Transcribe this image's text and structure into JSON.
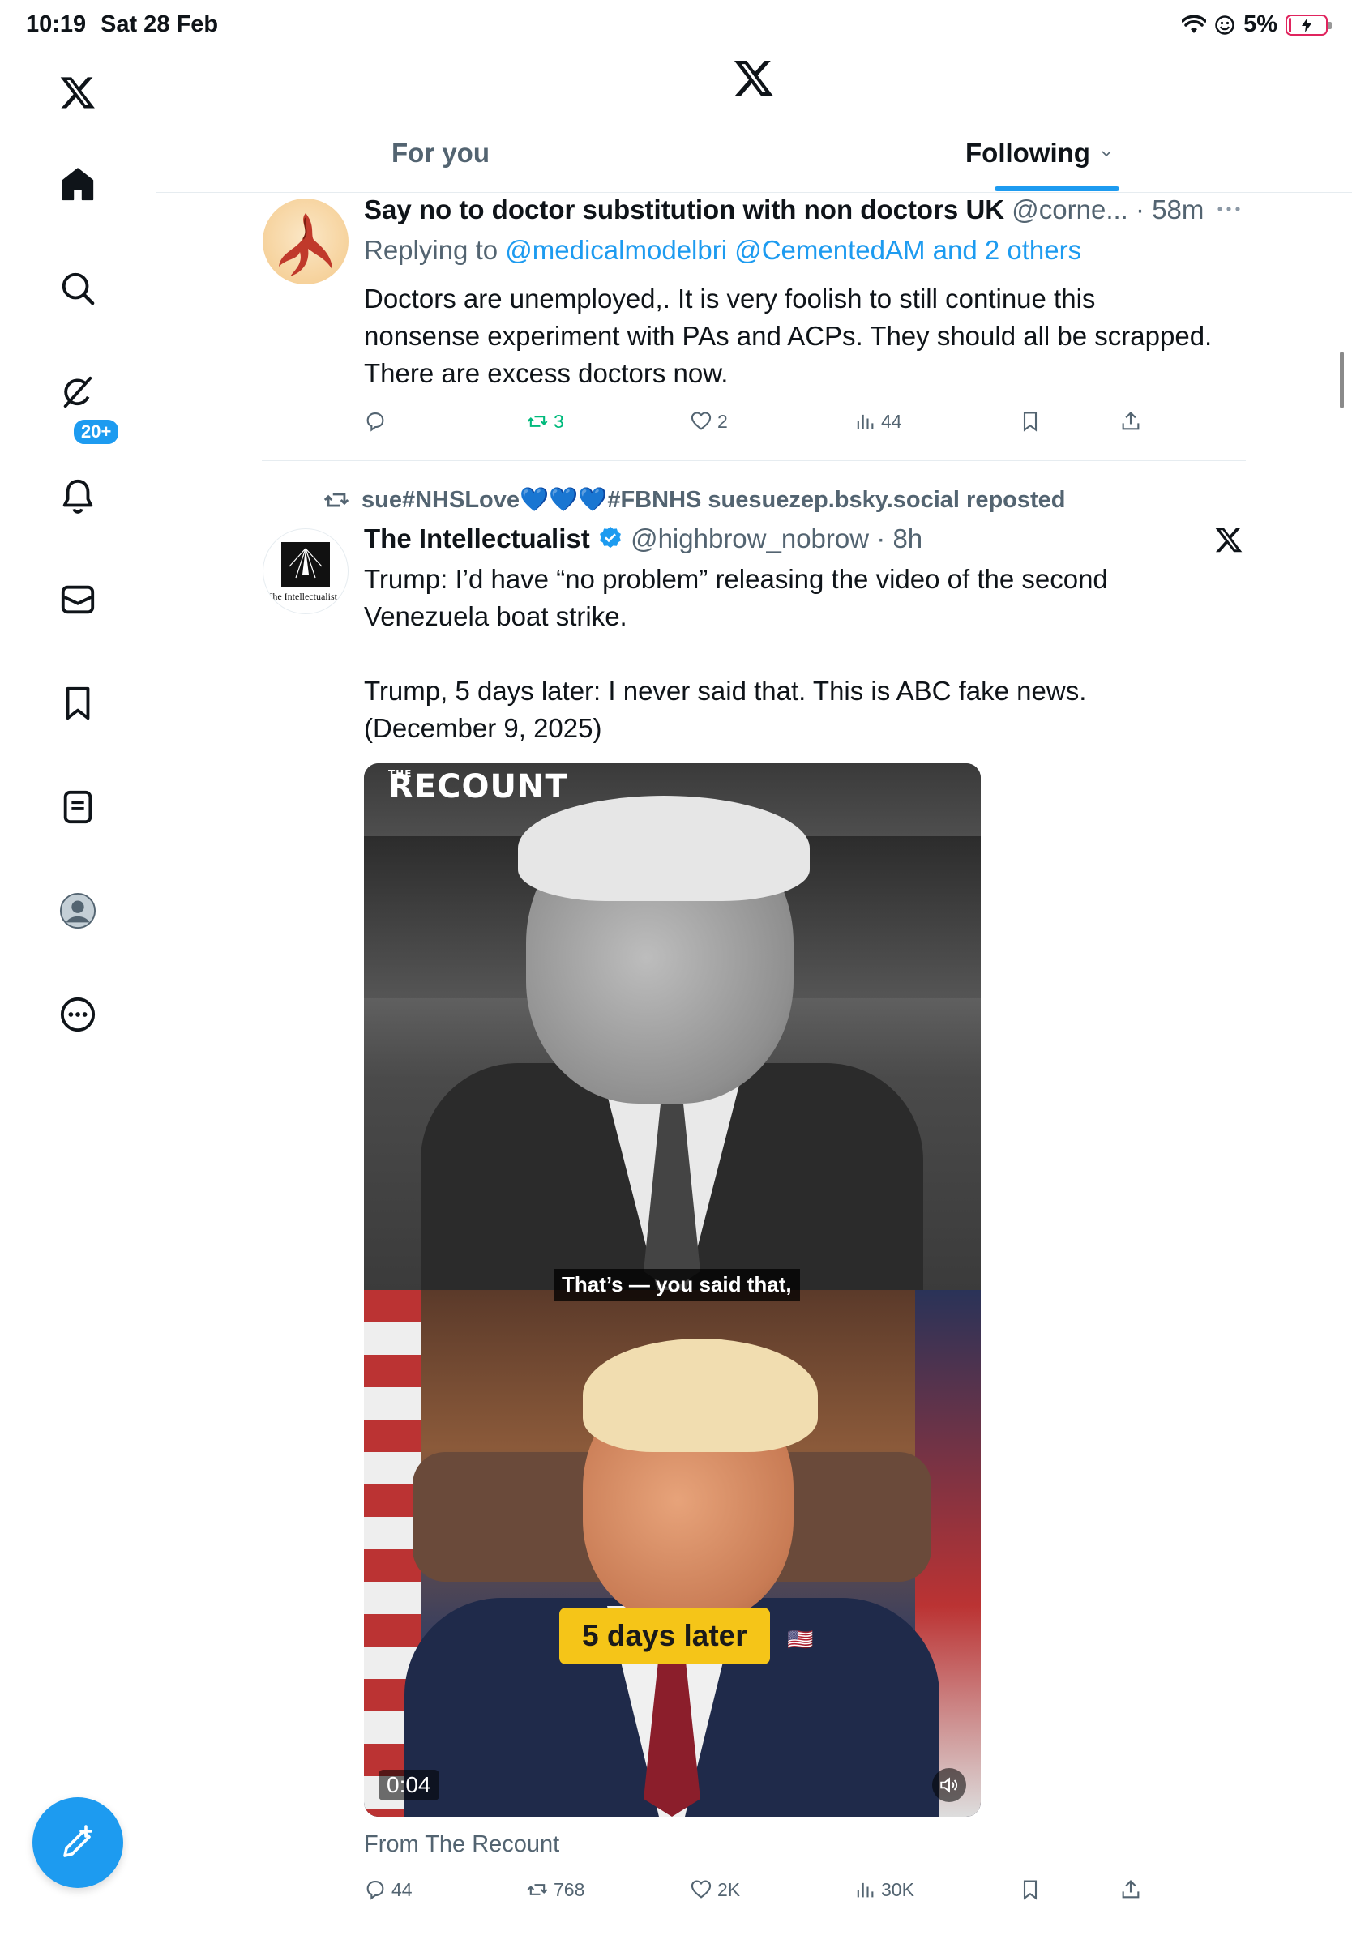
{
  "status_bar": {
    "time": "10:19",
    "date": "Sat 28 Feb",
    "battery": "5%"
  },
  "sidebar": {
    "items": [
      {
        "name": "x-logo-icon"
      },
      {
        "name": "home-icon"
      },
      {
        "name": "search-icon"
      },
      {
        "name": "grok-icon"
      },
      {
        "name": "bell-icon"
      },
      {
        "name": "mail-icon"
      },
      {
        "name": "bookmark-icon"
      },
      {
        "name": "list-icon"
      },
      {
        "name": "profile-icon"
      },
      {
        "name": "more-icon"
      }
    ],
    "notification_badge": "20+"
  },
  "header": {
    "tabs": [
      {
        "label": "For you",
        "active": false
      },
      {
        "label": "Following",
        "active": true
      }
    ]
  },
  "tweets": [
    {
      "author_name": "Say no to doctor substitution with non doctors UK",
      "handle": "@corne...",
      "time": "58m",
      "replying_prefix": "Replying to",
      "replying_to": "@medicalmodelbri @CementedAM and 2 others",
      "body": [
        "Doctors are unemployed,. It is very foolish to still continue this",
        "nonsense experiment with PAs and ACPs. They should all be scrapped.",
        "There are excess doctors now."
      ],
      "stats": {
        "replies": "",
        "reposts": "3",
        "likes": "2",
        "views": "44"
      }
    },
    {
      "repost_by": "sue#NHSLove💙💙💙#FBNHS suesuezep.bsky.social reposted",
      "author_name": "The Intellectualist",
      "avatar_text": "The Intellectualist",
      "handle": "@highbrow_nobrow",
      "time": "8h",
      "body": [
        "Trump: I’d have “no problem” releasing the video of the second",
        "Venezuela boat strike.",
        "",
        "Trump, 5 days later: I never said that. This is ABC fake news.",
        "(December 9, 2025)"
      ],
      "video": {
        "brand": "RECOUNT",
        "brand_small": "THE",
        "subtitle": "That’s — you said that,",
        "caption": "5 days later",
        "duration": "0:04"
      },
      "source": "From The Recount",
      "stats": {
        "replies": "44",
        "reposts": "768",
        "likes": "2K",
        "views": "30K"
      }
    }
  ],
  "colors": {
    "accent": "#1d9bf0",
    "repost_green": "#00ba7c",
    "text_secondary": "#536471",
    "caption_yellow": "#f5c518"
  }
}
